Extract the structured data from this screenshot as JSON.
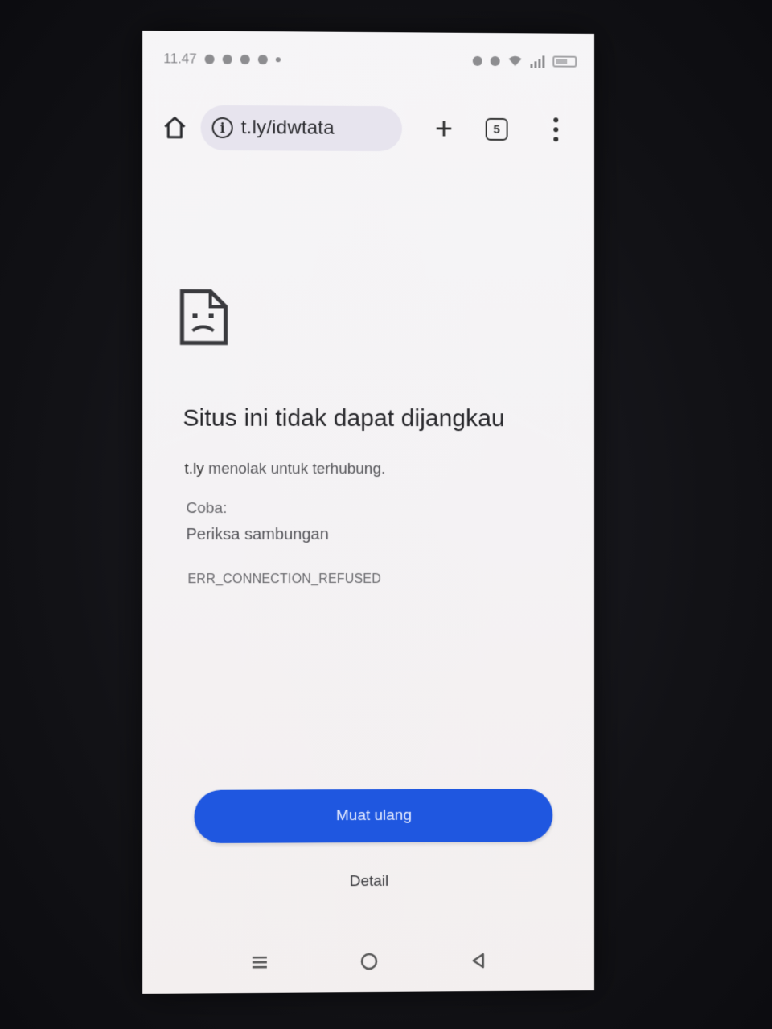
{
  "status_bar": {
    "time": "11.47",
    "battery_level": 0.45
  },
  "toolbar": {
    "url": "t.ly/idwtata",
    "tab_count": "5",
    "new_tab_symbol": "+"
  },
  "error": {
    "title": "Situs ini tidak dapat dijangkau",
    "host": "t.ly",
    "description": " menolak untuk terhubung.",
    "try_label": "Coba:",
    "suggestion": "Periksa sambungan",
    "code": "ERR_CONNECTION_REFUSED"
  },
  "actions": {
    "reload_label": "Muat ulang",
    "details_label": "Detail"
  },
  "colors": {
    "accent": "#1f57e0",
    "page_bg": "#f4f2f4"
  },
  "icons": {
    "home": "home-icon",
    "info": "info-icon",
    "new_tab": "plus-icon",
    "tabs": "tab-switcher-icon",
    "menu": "more-vert-icon",
    "error": "sad-page-icon",
    "nav_recents": "recents-icon",
    "nav_home": "nav-home-icon",
    "nav_back": "back-icon"
  }
}
